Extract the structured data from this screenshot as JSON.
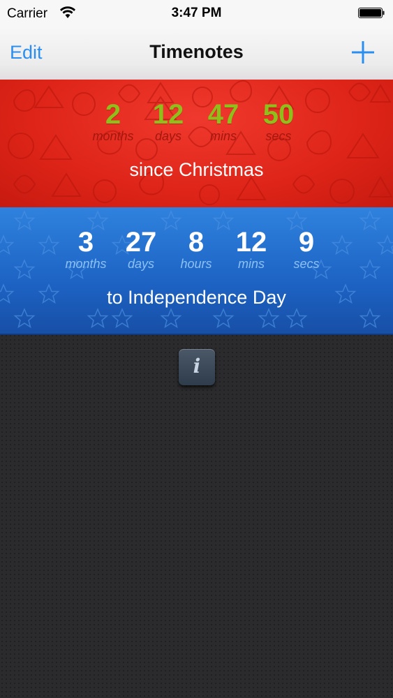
{
  "status_bar": {
    "carrier": "Carrier",
    "time": "3:47 PM"
  },
  "nav": {
    "edit_label": "Edit",
    "title": "Timenotes",
    "add_icon": "plus-icon"
  },
  "timenotes": [
    {
      "theme": "red",
      "counters": [
        {
          "value": "2",
          "unit": "months"
        },
        {
          "value": "12",
          "unit": "days"
        },
        {
          "value": "47",
          "unit": "mins"
        },
        {
          "value": "50",
          "unit": "secs"
        }
      ],
      "caption": "since Christmas"
    },
    {
      "theme": "blue",
      "counters": [
        {
          "value": "3",
          "unit": "months"
        },
        {
          "value": "27",
          "unit": "days"
        },
        {
          "value": "8",
          "unit": "hours"
        },
        {
          "value": "12",
          "unit": "mins"
        },
        {
          "value": "9",
          "unit": "secs"
        }
      ],
      "caption": "to Independence Day"
    }
  ],
  "info_button": {
    "glyph": "i",
    "icon": "info-icon"
  },
  "colors": {
    "accent": "#2a8ef0",
    "red_card": "#de2418",
    "red_number": "#8fbf1a",
    "blue_card": "#1d63c4",
    "background": "#2b2b2d"
  }
}
